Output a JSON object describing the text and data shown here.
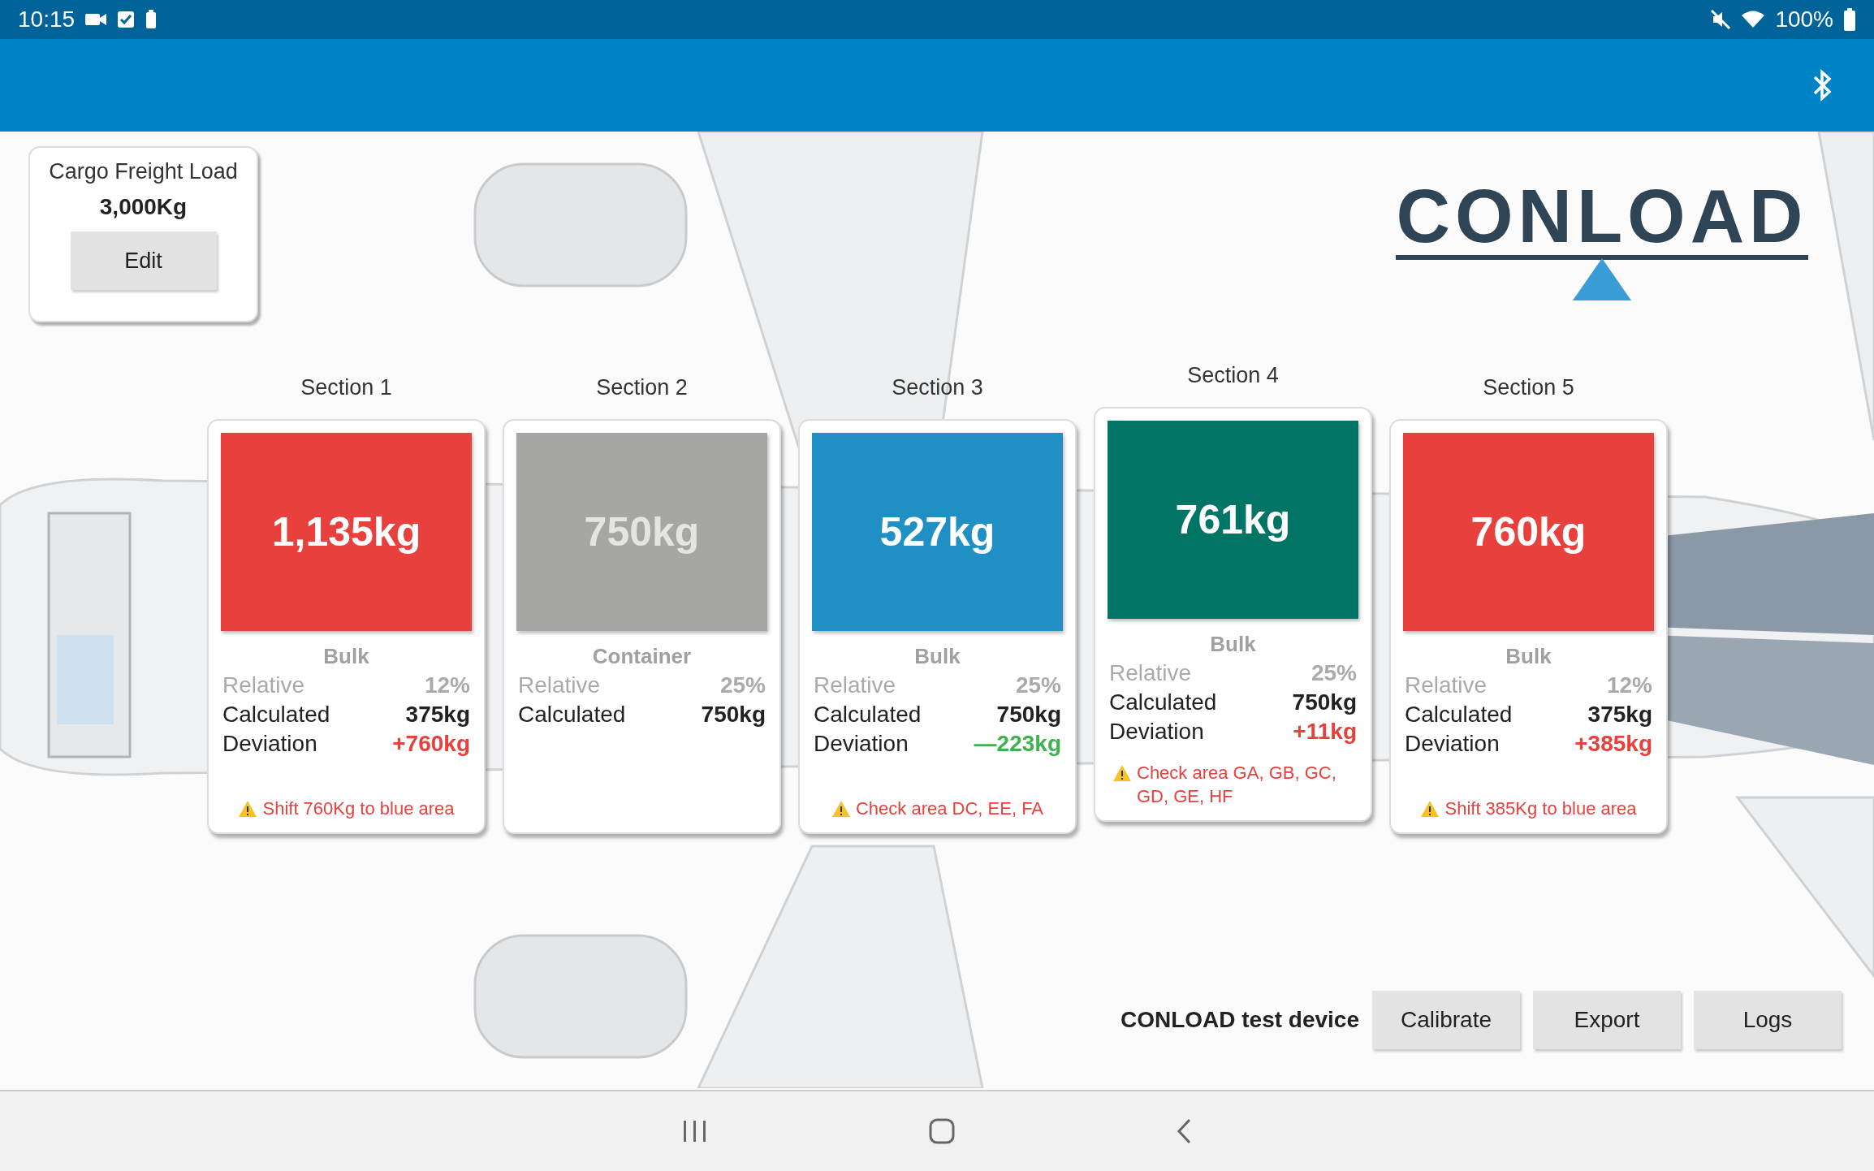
{
  "status_bar": {
    "time": "10:15",
    "battery": "100%"
  },
  "freight": {
    "title": "Cargo Freight Load",
    "value": "3,000Kg",
    "button": "Edit"
  },
  "logo": "CONLOAD",
  "sections": [
    {
      "label": "Section 1",
      "value": "1,135kg",
      "color": "#e8403c",
      "inactive": false,
      "selected": false,
      "type": "Bulk",
      "relative_label": "Relative",
      "relative": "12%",
      "calculated_label": "Calculated",
      "calculated": "375kg",
      "deviation_label": "Deviation",
      "deviation": {
        "text": "+760kg",
        "color": "#e8403c"
      },
      "warning": "Shift 760Kg to blue area"
    },
    {
      "label": "Section 2",
      "value": "750kg",
      "color": "#a6a7a5",
      "inactive": true,
      "selected": false,
      "type": "Container",
      "relative_label": "Relative",
      "relative": "25%",
      "calculated_label": "Calculated",
      "calculated": "750kg"
    },
    {
      "label": "Section 3",
      "value": "527kg",
      "color": "#1f8fc4",
      "inactive": false,
      "selected": false,
      "type": "Bulk",
      "relative_label": "Relative",
      "relative": "25%",
      "calculated_label": "Calculated",
      "calculated": "750kg",
      "deviation_label": "Deviation",
      "deviation": {
        "text": "—223kg",
        "color": "#3fb24f"
      },
      "warning": "Check area DC, EE, FA"
    },
    {
      "label": "Section 4",
      "value": "761kg",
      "color": "#007566",
      "inactive": false,
      "selected": true,
      "type": "Bulk",
      "relative_label": "Relative",
      "relative": "25%",
      "calculated_label": "Calculated",
      "calculated": "750kg",
      "deviation_label": "Deviation",
      "deviation": {
        "text": "+11kg",
        "color": "#e8403c"
      },
      "warning": "Check area GA, GB, GC, GD, GE, HF"
    },
    {
      "label": "Section 5",
      "value": "760kg",
      "color": "#e8403c",
      "inactive": false,
      "selected": false,
      "type": "Bulk",
      "relative_label": "Relative",
      "relative": "12%",
      "calculated_label": "Calculated",
      "calculated": "375kg",
      "deviation_label": "Deviation",
      "deviation": {
        "text": "+385kg",
        "color": "#e8403c"
      },
      "warning": "Shift 385Kg to blue area"
    }
  ],
  "device": "CONLOAD test device",
  "buttons": [
    "Calibrate",
    "Export",
    "Logs"
  ]
}
